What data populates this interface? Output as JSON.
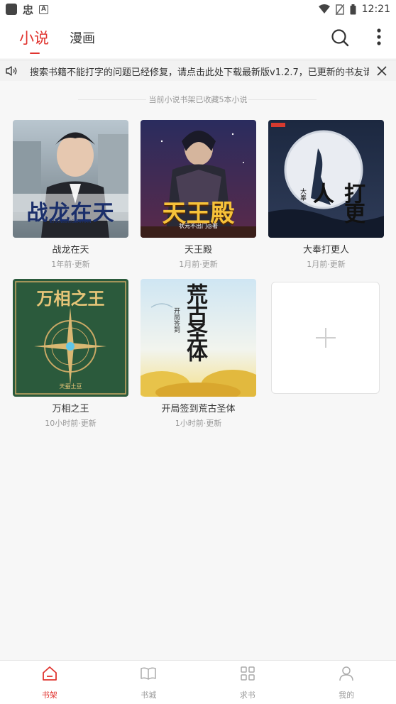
{
  "statusbar": {
    "time": "12:21",
    "app_glyph": "忠",
    "a_glyph": "A"
  },
  "tabs": [
    {
      "label": "小说",
      "active": true
    },
    {
      "label": "漫画",
      "active": false
    }
  ],
  "notice": {
    "text": "搜索书籍不能打字的问题已经修复，请点击此处下载最新版v1.2.7，已更新的书友请"
  },
  "shelf_info": "当前小说书架已收藏5本小说",
  "books": [
    {
      "title": "战龙在天",
      "update": "1年前·更新",
      "cover_text": "战龙在天",
      "cover_sub": "ZHANLONGZAITIAN"
    },
    {
      "title": "天王殿",
      "update": "1月前·更新",
      "cover_text": "天王殿",
      "cover_sub": "状元不出门◎著"
    },
    {
      "title": "大奉打更人",
      "update": "1月前·更新",
      "cover_text": "打更人",
      "cover_sub": "大奉"
    },
    {
      "title": "万相之王",
      "update": "10小时前·更新",
      "cover_text": "万相之王",
      "cover_sub": "天蚕土豆"
    },
    {
      "title": "开局签到荒古圣体",
      "update": "1小时前·更新",
      "cover_text": "荒古圣体",
      "cover_sub": "开局签到"
    }
  ],
  "bottom_nav": [
    {
      "label": "书架",
      "icon": "home-icon",
      "active": true
    },
    {
      "label": "书城",
      "icon": "book-open-icon",
      "active": false
    },
    {
      "label": "求书",
      "icon": "grid-icon",
      "active": false
    },
    {
      "label": "我的",
      "icon": "user-icon",
      "active": false
    }
  ],
  "colors": {
    "accent": "#e0342f",
    "muted": "#999999"
  }
}
